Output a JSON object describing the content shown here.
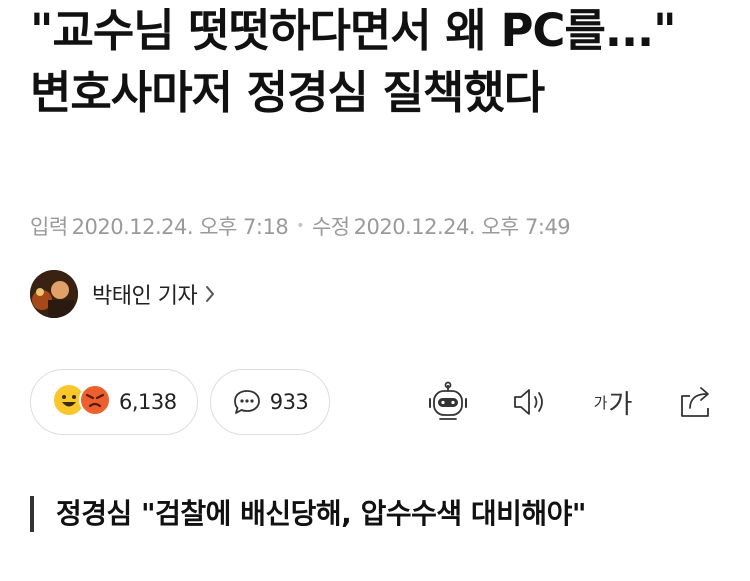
{
  "article": {
    "headline": "\"교수님 떳떳하다면서 왜 PC를...\" 변호사마저 정경심 질책했다",
    "input_label": "입력",
    "input_time": "2020.12.24. 오후 7:18",
    "separator": "•",
    "edit_label": "수정",
    "edit_time": "2020.12.24. 오후 7:49",
    "author": "박태인 기자",
    "subheadline": "정경심 \"검찰에 배신당해, 압수수색 대비해야\""
  },
  "actions": {
    "reaction_count": "6,138",
    "comment_count": "933",
    "font_small": "가",
    "font_large": "가"
  },
  "icons": {
    "reaction_happy": "smile-emoji-icon",
    "reaction_angry": "angry-emoji-icon",
    "comment": "speech-bubble-icon",
    "summary_bot": "robot-icon",
    "listen": "speaker-icon",
    "font_size": "font-size-icon",
    "share": "share-icon",
    "author_link": "chevron-right-icon"
  },
  "colors": {
    "text": "#111111",
    "meta": "#9a9a9a",
    "border": "#dddddd",
    "emoji_yellow": "#f9c62c",
    "emoji_red": "#ec5f2e"
  }
}
